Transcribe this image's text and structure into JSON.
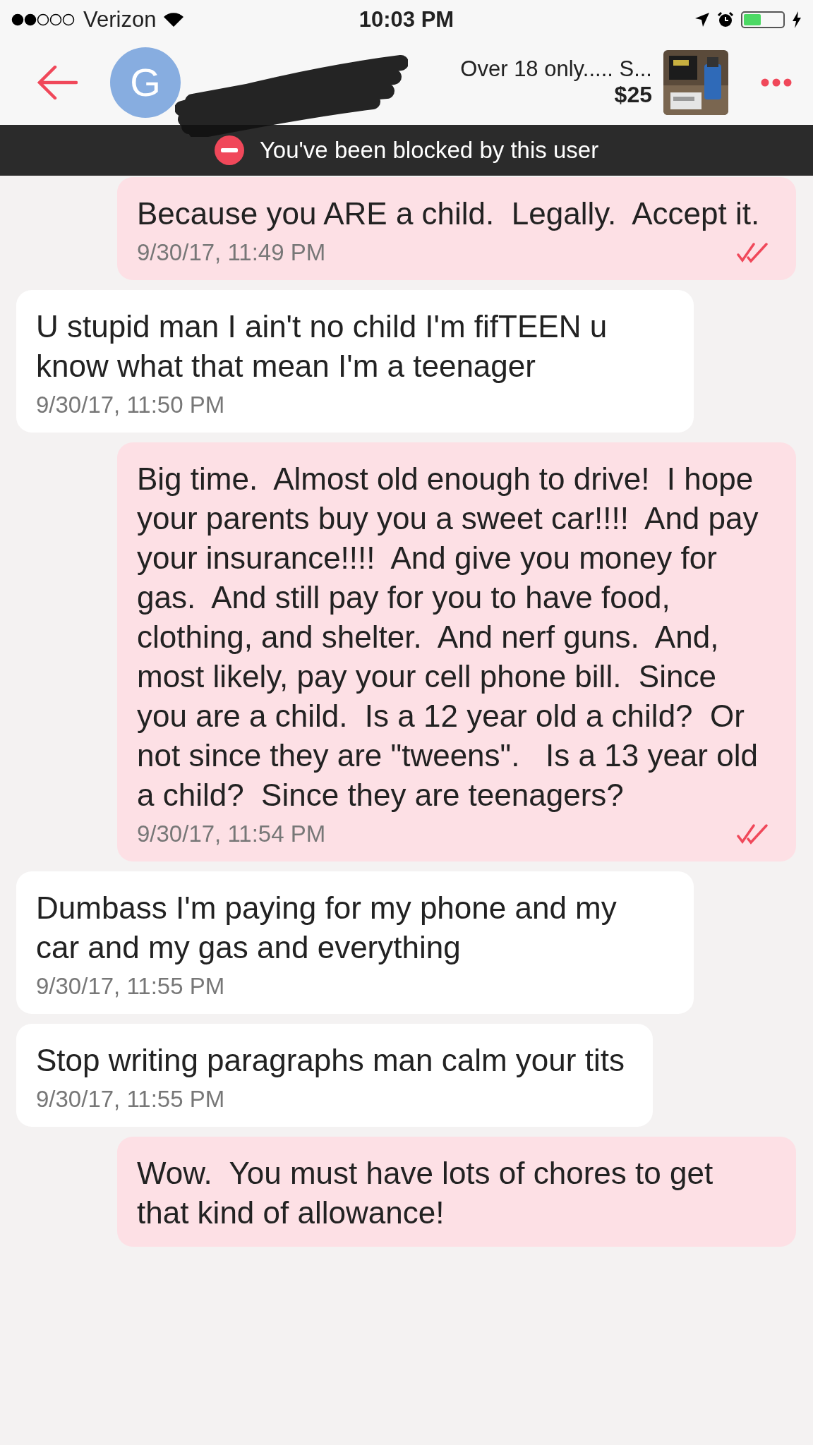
{
  "status_bar": {
    "carrier": "Verizon",
    "time": "10:03 PM"
  },
  "header": {
    "avatar_letter": "G",
    "listing_title": "Over 18 only..... S...",
    "listing_price": "$25"
  },
  "banner": {
    "text": "You've been blocked by this user"
  },
  "messages": [
    {
      "kind": "sent",
      "text": "Because you ARE a child.  Legally.  Accept it.",
      "time": "9/30/17, 11:49 PM",
      "read": true
    },
    {
      "kind": "received",
      "text": "U stupid man I ain't no child I'm fifTEEN u know what that mean I'm a teenager",
      "time": "9/30/17, 11:50 PM"
    },
    {
      "kind": "sent",
      "text": "Big time.  Almost old enough to drive!  I hope your parents buy you a sweet car!!!!  And pay your insurance!!!!  And give you money for gas.  And still pay for you to have food, clothing, and shelter.  And nerf guns.  And, most likely, pay your cell phone bill.  Since you are a child.  Is a 12 year old a child?  Or not since they are \"tweens\".   Is a 13 year old a child?  Since they are teenagers?",
      "time": "9/30/17, 11:54 PM",
      "read": true
    },
    {
      "kind": "received",
      "text": "Dumbass I'm paying for my phone and my car and my gas and everything",
      "time": "9/30/17, 11:55 PM"
    },
    {
      "kind": "received",
      "text": "Stop writing paragraphs man calm your tits",
      "time": "9/30/17, 11:55 PM"
    },
    {
      "kind": "sent",
      "text": "Wow.  You must have lots of chores to get that kind of allowance!"
    }
  ]
}
